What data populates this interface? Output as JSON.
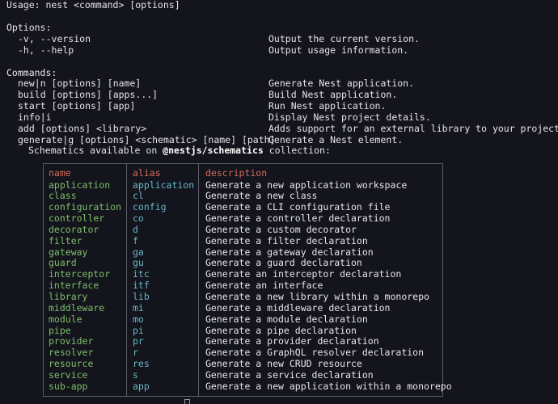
{
  "usage": "Usage: nest <command> [options]",
  "options_header": "Options:",
  "options": [
    {
      "flag": "-v, --version",
      "desc": "Output the current version."
    },
    {
      "flag": "-h, --help",
      "desc": "Output usage information."
    }
  ],
  "commands_header": "Commands:",
  "commands": [
    {
      "name": "new|n [options] [name]",
      "desc": "Generate Nest application."
    },
    {
      "name": "build [options] [apps...]",
      "desc": "Build Nest application."
    },
    {
      "name": "start [options] [app]",
      "desc": "Run Nest application."
    },
    {
      "name": "info|i",
      "desc": "Display Nest project details."
    },
    {
      "name": "add [options] <library>",
      "desc": "Adds support for an external library to your project."
    },
    {
      "name": "generate|g [options] <schematic> [name] [path]",
      "desc": "Generate a Nest element."
    }
  ],
  "schematics_note": {
    "prefix": "Schematics available on ",
    "collection": "@nestjs/schematics",
    "suffix": " collection:"
  },
  "table": {
    "headers": {
      "name": "name",
      "alias": "alias",
      "description": "description"
    },
    "rows": [
      {
        "name": "application",
        "alias": "application",
        "description": "Generate a new application workspace"
      },
      {
        "name": "class",
        "alias": "cl",
        "description": "Generate a new class"
      },
      {
        "name": "configuration",
        "alias": "config",
        "description": "Generate a CLI configuration file"
      },
      {
        "name": "controller",
        "alias": "co",
        "description": "Generate a controller declaration"
      },
      {
        "name": "decorator",
        "alias": "d",
        "description": "Generate a custom decorator"
      },
      {
        "name": "filter",
        "alias": "f",
        "description": "Generate a filter declaration"
      },
      {
        "name": "gateway",
        "alias": "ga",
        "description": "Generate a gateway declaration"
      },
      {
        "name": "guard",
        "alias": "gu",
        "description": "Generate a guard declaration"
      },
      {
        "name": "interceptor",
        "alias": "itc",
        "description": "Generate an interceptor declaration"
      },
      {
        "name": "interface",
        "alias": "itf",
        "description": "Generate an interface"
      },
      {
        "name": "library",
        "alias": "lib",
        "description": "Generate a new library within a monorepo"
      },
      {
        "name": "middleware",
        "alias": "mi",
        "description": "Generate a middleware declaration"
      },
      {
        "name": "module",
        "alias": "mo",
        "description": "Generate a module declaration"
      },
      {
        "name": "pipe",
        "alias": "pi",
        "description": "Generate a pipe declaration"
      },
      {
        "name": "provider",
        "alias": "pr",
        "description": "Generate a provider declaration"
      },
      {
        "name": "resolver",
        "alias": "r",
        "description": "Generate a GraphQL resolver declaration"
      },
      {
        "name": "resource",
        "alias": "res",
        "description": "Generate a new CRUD resource"
      },
      {
        "name": "service",
        "alias": "s",
        "description": "Generate a service declaration"
      },
      {
        "name": "sub-app",
        "alias": "app",
        "description": "Generate a new application within a monorepo"
      }
    ]
  },
  "colors": {
    "background": "#13141c",
    "text": "#e6e6ea",
    "header": "#d36d5a",
    "name": "#7fbf6a",
    "alias": "#67b7c7",
    "border": "#5a5d6b"
  }
}
